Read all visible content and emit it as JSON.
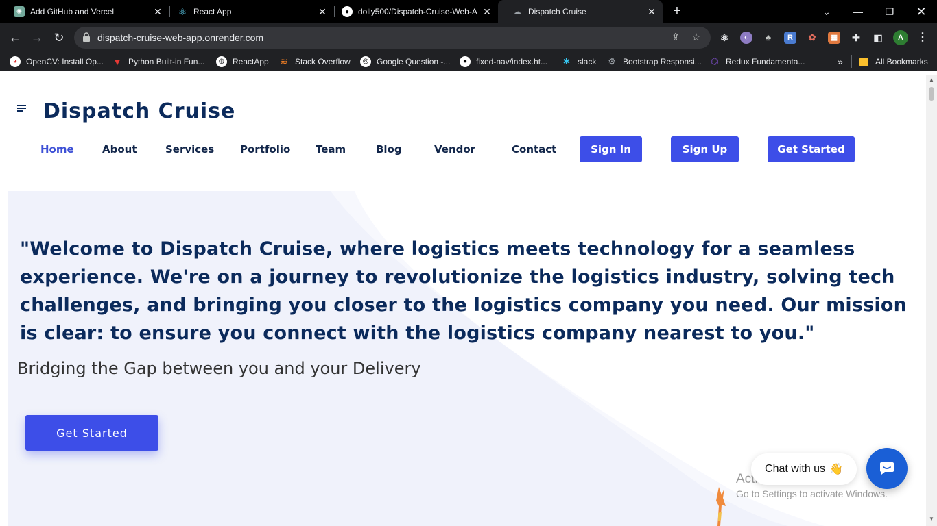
{
  "browser": {
    "tabs": [
      {
        "title": "Add GitHub and Vercel",
        "icon": "openai-icon"
      },
      {
        "title": "React App",
        "icon": "react-icon"
      },
      {
        "title": "dolly500/Dispatch-Cruise-Web-A",
        "icon": "github-icon"
      },
      {
        "title": "Dispatch Cruise",
        "icon": "site-icon",
        "active": true
      }
    ],
    "url": "dispatch-cruise-web-app.onrender.com",
    "bookmarks": [
      {
        "label": "OpenCV: Install Op...",
        "icon": "opencv-icon"
      },
      {
        "label": "Python Built-in Fun...",
        "icon": "python-icon"
      },
      {
        "label": "ReactApp",
        "icon": "globe-icon"
      },
      {
        "label": "Stack Overflow",
        "icon": "stackoverflow-icon"
      },
      {
        "label": "Google Question -...",
        "icon": "google-icon"
      },
      {
        "label": "fixed-nav/index.ht...",
        "icon": "github-icon"
      },
      {
        "label": "slack",
        "icon": "slack-icon"
      },
      {
        "label": "Bootstrap Responsi...",
        "icon": "bootstrap-icon"
      },
      {
        "label": "Redux Fundamenta...",
        "icon": "redux-icon"
      }
    ],
    "all_bookmarks": "All Bookmarks",
    "profile_initial": "A"
  },
  "site": {
    "brand": "Dispatch Cruise",
    "nav": [
      "Home",
      "About",
      "Services",
      "Portfolio",
      "Team",
      "Blog",
      "Vendor",
      "Contact"
    ],
    "sign_in": "Sign In",
    "sign_up": "Sign Up",
    "get_started": "Get Started"
  },
  "hero": {
    "quote": "\"Welcome to Dispatch Cruise, where logistics meets technology for a seamless experience. We're on a journey to revolutionize the logistics industry, solving tech challenges, and bringing you closer to the logistics company you need. Our mission is clear: to ensure you connect with the logistics company nearest to you.\"",
    "tagline": "Bridging the Gap between you and your Delivery",
    "cta": "Get Started"
  },
  "chat": {
    "label": "Chat with us",
    "emoji": "👋"
  },
  "os_overlay": {
    "title": "Activate Windows",
    "subtitle": "Go to Settings to activate Windows."
  },
  "colors": {
    "brand_navy": "#0b2a5b",
    "button_blue": "#3d4ee8",
    "nav_active": "#3d50d6",
    "chat_blue": "#1a5fd6"
  }
}
